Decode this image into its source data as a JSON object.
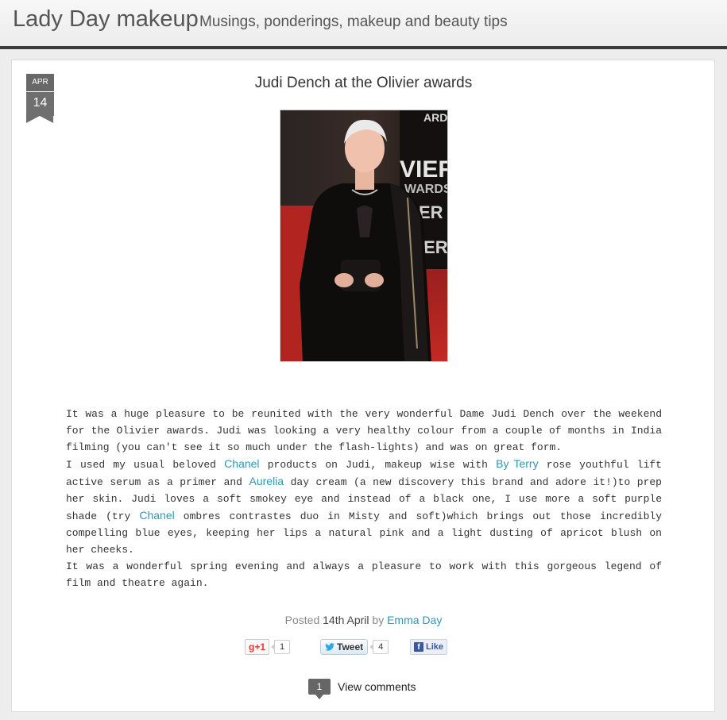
{
  "header": {
    "title": "Lady Day makeup",
    "tagline": "Musings, ponderings, makeup and beauty tips"
  },
  "post": {
    "date": {
      "month": "APR",
      "day": "14"
    },
    "title": "Judi Dench at the Olivier awards",
    "photo_alt": "Judi Dench on the red carpet at the Olivier Awards",
    "body": {
      "p1": "It was a huge pleasure to be reunited with the very wonderful Dame Judi Dench over the weekend for the Olivier awards. Judi was looking a very healthy colour from a couple of months in India filming (you can't see it so much under the flash-lights) and was on great form.",
      "p2": {
        "t1": "I used my usual beloved ",
        "link1": "Chanel",
        "t2": " products on Judi, makeup wise with ",
        "link2": "By Terry",
        "t3": " rose youthful lift active serum as a primer and ",
        "link3": "Aurelia",
        "t4": " day cream (a new discovery this brand and adore it!)to prep her skin. Judi loves a soft smokey eye and instead of a black one, I use more a soft purple shade (try ",
        "link4": "Chanel",
        "t5": " ombres contrastes duo in Misty and soft)which brings out those incredibly compelling blue eyes, keeping her lips a natural pink and a light dusting of apricot blush  on her cheeks."
      },
      "p3": "It was a wonderful spring evening and always a pleasure to work with this gorgeous legend of film and theatre again."
    },
    "meta": {
      "posted": "Posted",
      "date": "14th April",
      "by": "by",
      "author": "Emma Day"
    },
    "share": {
      "gplus_label": "g+1",
      "gplus_count": "1",
      "tweet_label": "Tweet",
      "tweet_count": "4",
      "like_label": "Like"
    },
    "comments": {
      "count": "1",
      "label": "View comments"
    }
  },
  "colors": {
    "link": "#2a9ab3",
    "header_border": "#3a3a3a",
    "badge": "#6f6f6f"
  }
}
